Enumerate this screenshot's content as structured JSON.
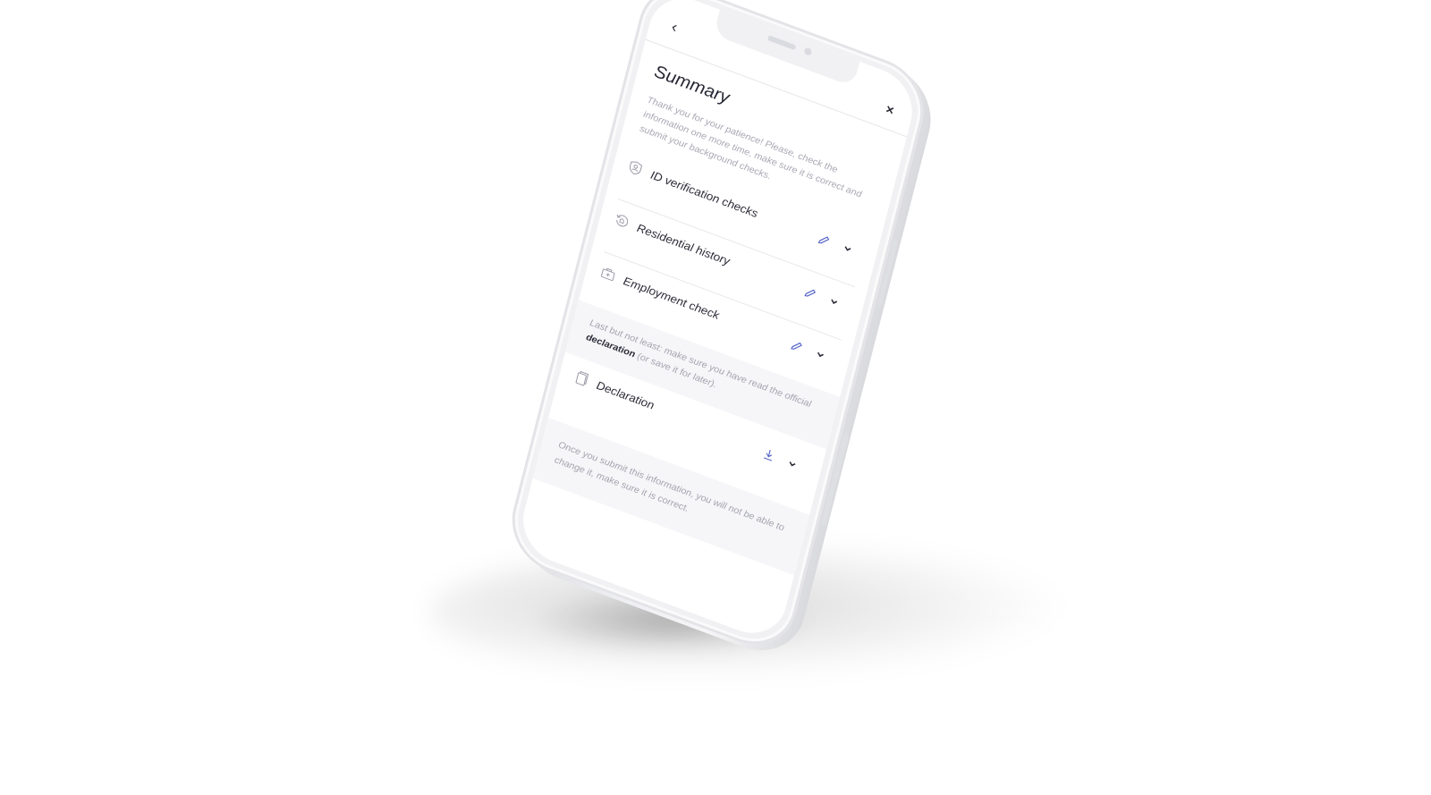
{
  "header": {
    "back_glyph": "‹",
    "close_glyph": "×"
  },
  "summary": {
    "title": "Summary",
    "intro": "Thank you for your patience! Please, check the information one more time, make sure it is correct and submit your background checks."
  },
  "checks": [
    {
      "label": "ID verification checks",
      "icon": "id-shield-icon",
      "action_icon": "pencil-icon"
    },
    {
      "label": "Residential history",
      "icon": "history-icon",
      "action_icon": "pencil-icon"
    },
    {
      "label": "Employment check",
      "icon": "briefcase-icon",
      "action_icon": "pencil-icon"
    }
  ],
  "declaration_note": {
    "before": "Last but not least: make sure you have read the official ",
    "emphasis": "declaration",
    "after": " (or save it for later)."
  },
  "declaration": {
    "label": "Declaration",
    "icon": "document-icon",
    "action_icon": "download-icon"
  },
  "footer_note": "Once you submit this information, you will not be able to change it, make sure it is correct.",
  "colors": {
    "accent": "#5060c8",
    "text_dark": "#2b2b38",
    "text_muted": "#a3a3b0",
    "panel_bg": "#f6f6f8",
    "device": "#f1f1f3"
  }
}
